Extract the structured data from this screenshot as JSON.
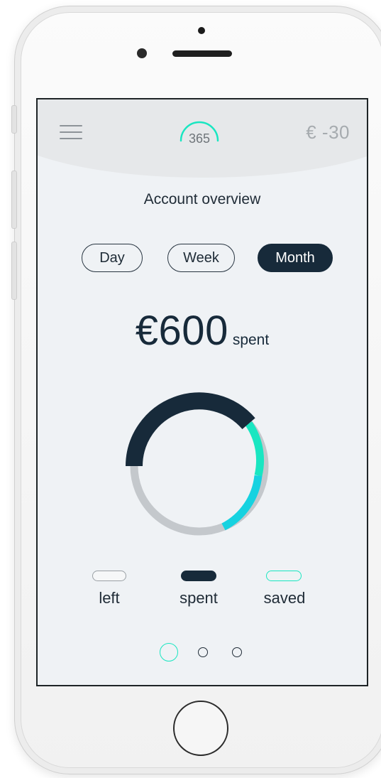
{
  "header": {
    "menu_icon": "hamburger-menu-icon",
    "logo_number": "365",
    "balance": "€ -30"
  },
  "overview": {
    "title": "Account overview",
    "periods": [
      "Day",
      "Week",
      "Month"
    ],
    "selected_period": "Month",
    "amount": "€600",
    "amount_label": "spent"
  },
  "chart_data": {
    "type": "donut",
    "segments": [
      {
        "name": "spent",
        "color": "#172a3a"
      },
      {
        "name": "saved",
        "color": "#19e6c1"
      },
      {
        "name": "left",
        "color": "#c4c8cc"
      }
    ]
  },
  "legend": {
    "left": "left",
    "spent": "spent",
    "saved": "saved"
  },
  "pagination": {
    "total": 3,
    "current": 1
  },
  "colors": {
    "accent": "#19e6c1",
    "dark": "#172a3a",
    "background": "#eff2f5"
  }
}
